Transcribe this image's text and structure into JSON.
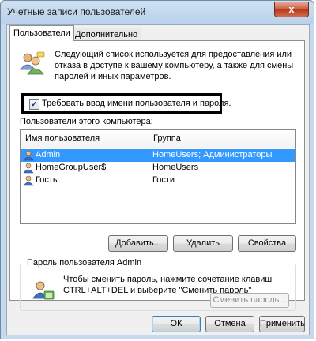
{
  "window": {
    "title": "Учетные записи пользователей",
    "close_glyph": "x"
  },
  "tabs": [
    {
      "label": "Пользователи",
      "active": true
    },
    {
      "label": "Дополнительно",
      "active": false
    }
  ],
  "users_tab": {
    "intro_text": "Следующий список используется для предоставления или отказа в доступе к вашему компьютеру, а также для смены паролей и иных параметров.",
    "require_login_checkbox": {
      "label": "Требовать ввод имени пользователя и пароля.",
      "checked": true,
      "check_glyph": "✓"
    },
    "list_caption": "Пользователи этого компьютера:",
    "columns": [
      "Имя пользователя",
      "Группа"
    ],
    "users": [
      {
        "name": "Admin",
        "group": "HomeUsers; Администраторы",
        "selected": true
      },
      {
        "name": "HomeGroupUser$",
        "group": "HomeUsers",
        "selected": false
      },
      {
        "name": "Гость",
        "group": "Гости",
        "selected": false
      }
    ],
    "buttons": {
      "add": "Добавить...",
      "remove": "Удалить",
      "properties": "Свойства"
    },
    "password_group": {
      "title": "Пароль пользователя Admin",
      "text": "Чтобы сменить пароль, нажмите сочетание клавиш CTRL+ALT+DEL и выберите \"Сменить пароль\"",
      "change_button": "Сменить пароль..."
    }
  },
  "dialog_buttons": {
    "ok": "ОК",
    "cancel": "Отмена",
    "apply": "Применить"
  },
  "icons": {
    "users": "users-icon",
    "user_row": "user-icon",
    "password": "password-user-icon",
    "close": "close-icon"
  },
  "colors": {
    "selection": "#3399ff",
    "title_bar": "#b9d1ea",
    "close_button": "#c75a3d"
  }
}
